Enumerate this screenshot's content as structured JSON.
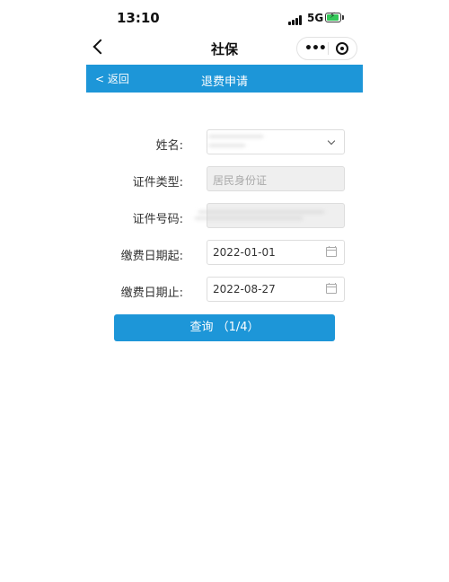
{
  "status_bar": {
    "time": "13:10",
    "network": "5G"
  },
  "nav": {
    "title": "社保"
  },
  "header": {
    "back_label": "返回",
    "title": "退费申请"
  },
  "form": {
    "name_label": "姓名:",
    "id_type_label": "证件类型:",
    "id_type_placeholder": "居民身份证",
    "id_number_label": "证件号码:",
    "start_date_label": "缴费日期起:",
    "start_date_value": "2022-01-01",
    "end_date_label": "缴费日期止:",
    "end_date_value": "2022-08-27"
  },
  "query_button": {
    "label": "查询 （1/4）"
  },
  "icons": [
    "back-chevron-icon",
    "more-icon",
    "target-icon",
    "signal-icon",
    "battery-icon",
    "chevron-down-icon",
    "calendar-icon"
  ],
  "colors": {
    "accent": "#1d96d8",
    "battery": "#34c759"
  }
}
